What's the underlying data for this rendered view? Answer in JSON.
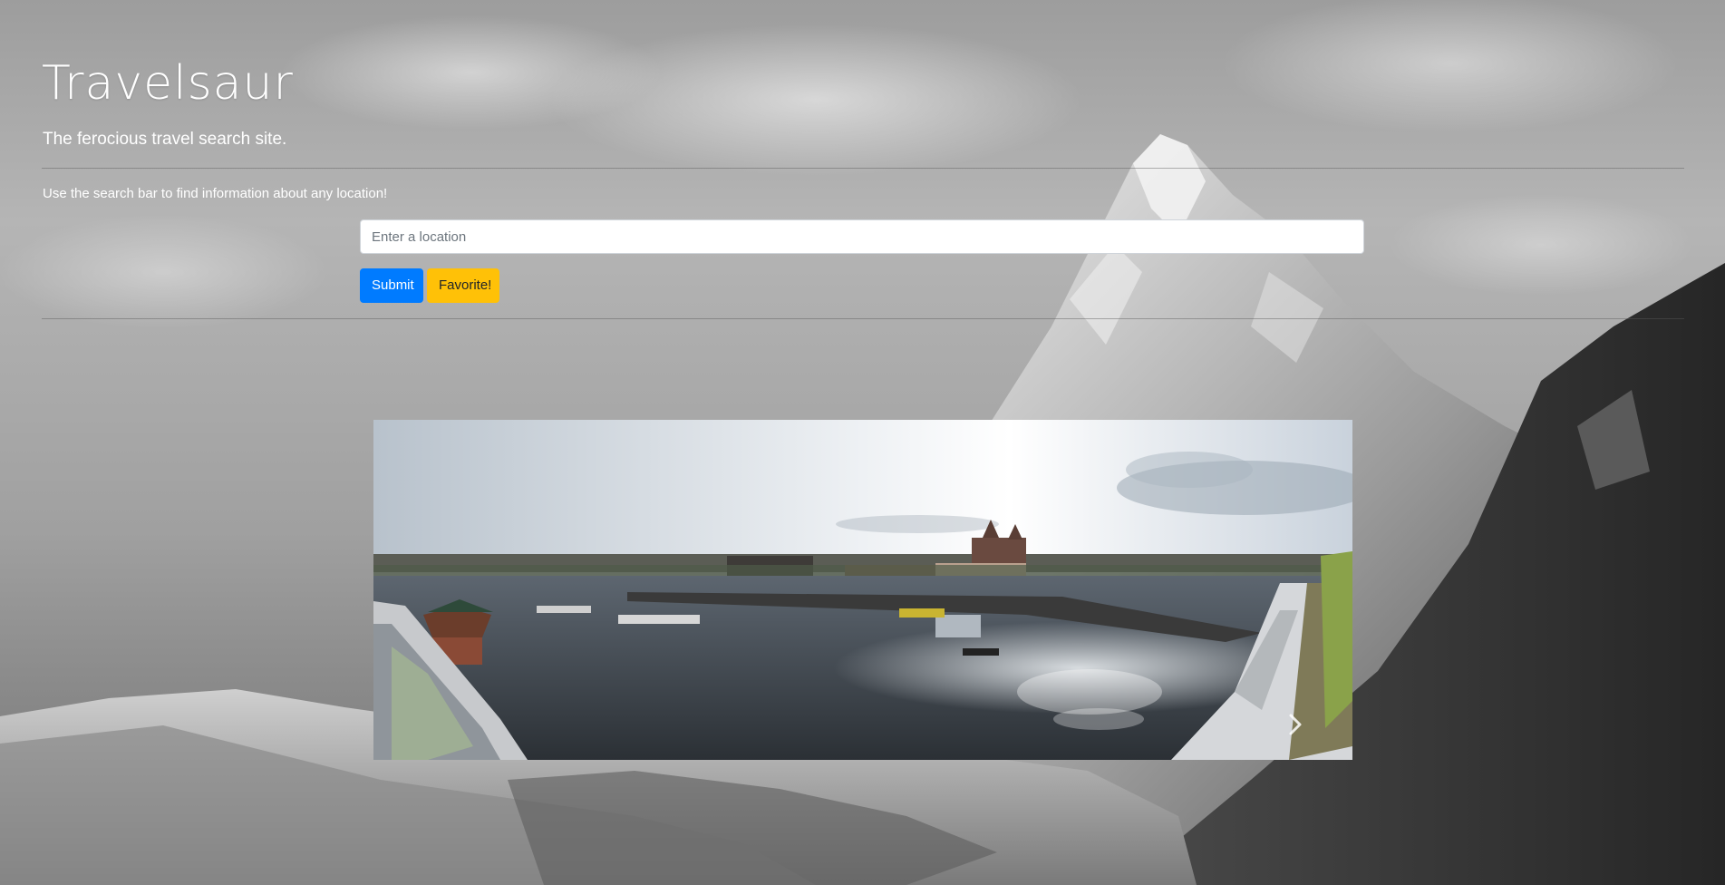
{
  "site": {
    "title": "Travelsaur",
    "subtitle": "The ferocious travel search site.",
    "instructions": "Use the search bar to find information about any location!"
  },
  "search": {
    "placeholder": "Enter a location",
    "value": ""
  },
  "buttons": {
    "submit_label": "Submit",
    "favorite_label": "Favorite!"
  },
  "carousel": {
    "next_icon": "chevron-right-icon"
  },
  "colors": {
    "submit": "#007bff",
    "favorite": "#ffc107"
  }
}
